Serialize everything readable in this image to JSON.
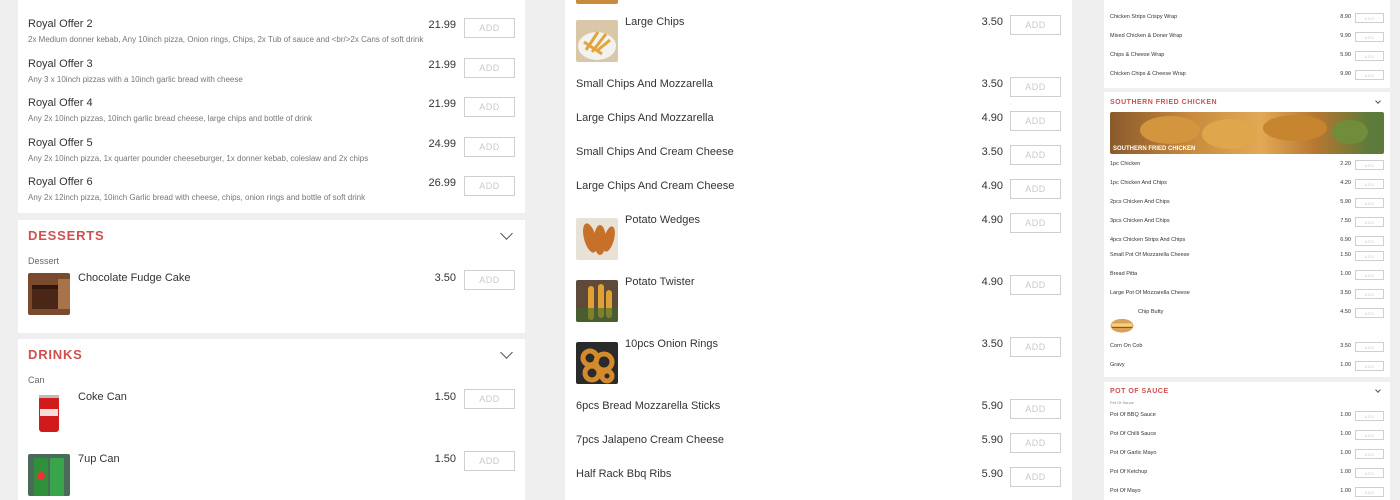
{
  "add_label": "ADD",
  "col1": {
    "offers": [
      {
        "name": "Royal Offer 2",
        "desc": "2x Medium donner kebab, Any 10inch pizza, Onion rings, Chips, 2x Tub of sauce and <br/>2x Cans of soft drink",
        "price": "21.99"
      },
      {
        "name": "Royal Offer 3",
        "desc": "Any 3 x 10inch pizzas with a 10inch garlic bread with cheese",
        "price": "21.99"
      },
      {
        "name": "Royal Offer 4",
        "desc": "Any 2x 10inch pizzas, 10inch garlic bread cheese, large chips and bottle of drink",
        "price": "21.99"
      },
      {
        "name": "Royal Offer 5",
        "desc": "Any 2x 10inch pizza, 1x quarter pounder cheeseburger, 1x donner kebab, coleslaw and 2x chips",
        "price": "24.99"
      },
      {
        "name": "Royal Offer 6",
        "desc": "Any 2x 12inch pizza, 10inch Garlic bread with cheese, chips, onion rings and bottle of soft drink",
        "price": "26.99"
      }
    ],
    "desserts": {
      "title": "DESSERTS",
      "subcat": "Dessert",
      "items": [
        {
          "name": "Chocolate Fudge Cake",
          "price": "3.50",
          "img": "cake"
        }
      ]
    },
    "drinks": {
      "title": "DRINKS",
      "subcat": "Can",
      "items": [
        {
          "name": "Coke Can",
          "price": "1.50",
          "img": "coke"
        },
        {
          "name": "7up Can",
          "price": "1.50",
          "img": "7up"
        }
      ]
    }
  },
  "col2": {
    "items": [
      {
        "name": "Large Chips",
        "price": "3.50",
        "img": "chips"
      },
      {
        "name": "Small Chips And Mozzarella",
        "price": "3.50"
      },
      {
        "name": "Large Chips And Mozzarella",
        "price": "4.90"
      },
      {
        "name": "Small Chips And Cream Cheese",
        "price": "3.50"
      },
      {
        "name": "Large Chips And Cream Cheese",
        "price": "4.90"
      },
      {
        "name": "Potato Wedges",
        "price": "4.90",
        "img": "wedges"
      },
      {
        "name": "Potato Twister",
        "price": "4.90",
        "img": "twister"
      },
      {
        "name": "10pcs Onion Rings",
        "price": "3.50",
        "img": "rings"
      },
      {
        "name": "6pcs Bread Mozzarella Sticks",
        "price": "5.90"
      },
      {
        "name": "7pcs Jalapeno Cream Cheese",
        "price": "5.90"
      },
      {
        "name": "Half Rack Bbq Ribs",
        "price": "5.90"
      }
    ]
  },
  "col3": {
    "wraps": [
      {
        "name": "Chicken Strips Crispy Wrap",
        "price": "8.90"
      },
      {
        "name": "Mixed Chicken & Doner Wrap",
        "price": "9.90"
      },
      {
        "name": "Chips & Cheese Wrap",
        "price": "5.90"
      },
      {
        "name": "Chicken Chips & Cheese Wrap",
        "price": "9.90"
      }
    ],
    "sfc": {
      "title": "SOUTHERN FRIED CHICKEN",
      "banner": "SOUTHERN FRIED CHICKEN",
      "items": [
        {
          "name": "1pc Chicken",
          "price": "2.20"
        },
        {
          "name": "1pc Chicken And Chips",
          "price": "4.20"
        },
        {
          "name": "2pcs Chicken And Chips",
          "price": "5.90"
        },
        {
          "name": "3pcs Chicken And Chips",
          "price": "7.50"
        },
        {
          "name": "4pcs Chicken Strips And Chips",
          "price": "6.90"
        }
      ]
    },
    "sides": [
      {
        "name": "Small Pot Of Mozzarella Cheese",
        "price": "1.50"
      },
      {
        "name": "Bread Pitta",
        "price": "1.00"
      },
      {
        "name": "Large Pot Of Mozzarella Cheese",
        "price": "3.50"
      },
      {
        "name": "Chip Butty",
        "price": "4.50",
        "img": "butty"
      },
      {
        "name": "Corn On Cob",
        "price": "3.50"
      },
      {
        "name": "Gravy",
        "price": "1.00"
      }
    ],
    "sauce": {
      "title": "POT OF SAUCE",
      "subcat": "Pot Of Sauce",
      "items": [
        {
          "name": "Pot Of BBQ Sauce",
          "price": "1.00"
        },
        {
          "name": "Pot Of Chilli Sauce",
          "price": "1.00"
        },
        {
          "name": "Pot Of Garlic Mayo",
          "price": "1.00"
        },
        {
          "name": "Pot Of Ketchup",
          "price": "1.00"
        },
        {
          "name": "Pot Of Mayo",
          "price": "1.00"
        }
      ]
    }
  }
}
